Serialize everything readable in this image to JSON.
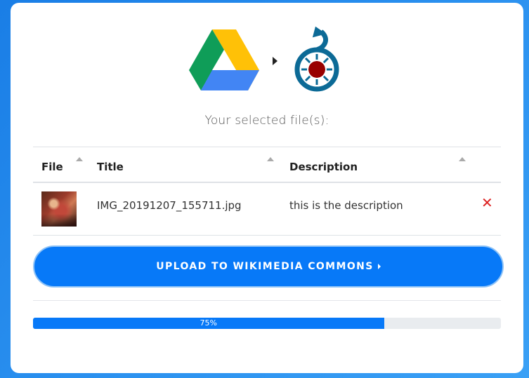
{
  "header": {
    "subtitle": "Your selected file(s):"
  },
  "icons": {
    "source": "google-drive-icon",
    "arrow": "caret-right-icon",
    "destination": "wikimedia-commons-icon"
  },
  "table": {
    "columns": [
      "File",
      "Title",
      "Description"
    ],
    "rows": [
      {
        "thumbnail": "photo-thumbnail",
        "title": "IMG_20191207_155711.jpg",
        "description": "this is the description",
        "remove_icon": "✕"
      }
    ]
  },
  "upload_button": {
    "label": "UPLOAD TO WIKIMEDIA COMMONS"
  },
  "progress": {
    "value": 75,
    "label": "75%"
  },
  "colors": {
    "accent": "#0779f8",
    "background": "#1a7ee6",
    "remove": "#dd2222"
  }
}
